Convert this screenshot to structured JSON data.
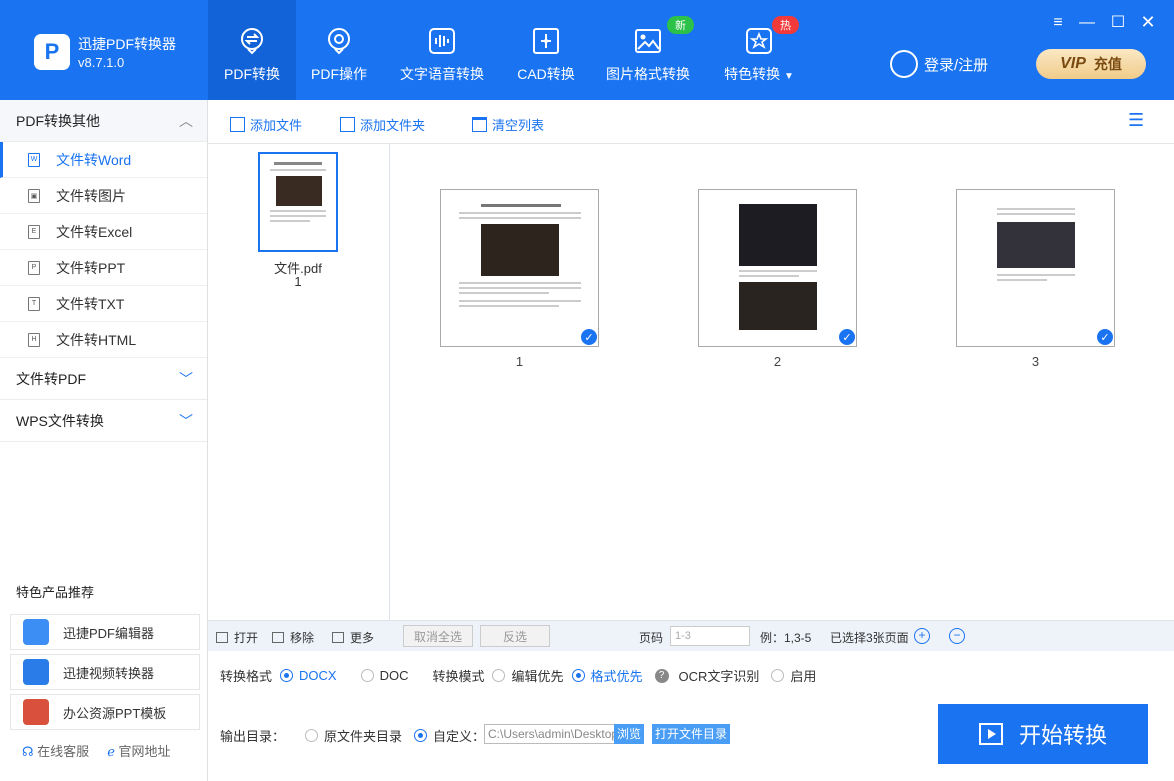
{
  "app": {
    "name": "迅捷PDF转换器",
    "version": "v8.7.1.0"
  },
  "nav": {
    "tabs": [
      {
        "label": "PDF转换",
        "icon": "pdf-convert-icon"
      },
      {
        "label": "PDF操作",
        "icon": "pdf-operate-icon"
      },
      {
        "label": "文字语音转换",
        "icon": "audio-wave-icon"
      },
      {
        "label": "CAD转换",
        "icon": "cad-icon"
      },
      {
        "label": "图片格式转换",
        "icon": "image-icon"
      },
      {
        "label": "特色转换",
        "icon": "star-convert-icon"
      }
    ],
    "badge_new": "新",
    "badge_hot": "热"
  },
  "header": {
    "login": "登录/注册",
    "vip": "VIP",
    "recharge": "充值"
  },
  "sidebar": {
    "section1": "PDF转换其他",
    "items": [
      "文件转Word",
      "文件转图片",
      "文件转Excel",
      "文件转PPT",
      "文件转TXT",
      "文件转HTML"
    ],
    "item_icons": [
      "W",
      "▣",
      "E",
      "P",
      "T",
      "H"
    ],
    "section2": "文件转PDF",
    "section3": "WPS文件转换",
    "rec_title": "特色产品推荐",
    "recs": [
      "迅捷PDF编辑器",
      "迅捷视频转换器",
      "办公资源PPT模板"
    ],
    "online_service": "在线客服",
    "website": "官网地址"
  },
  "toolbar": {
    "add_file": "添加文件",
    "add_folder": "添加文件夹",
    "clear_list": "清空列表"
  },
  "file": {
    "name": "文件.pdf",
    "pages": "1"
  },
  "pages": [
    "1",
    "2",
    "3"
  ],
  "bottombar": {
    "open": "打开",
    "remove": "移除",
    "more": "更多",
    "deselect_all": "取消全选",
    "invert": "反选",
    "page_label": "页码",
    "page_placeholder": "1-3",
    "example": "例：1,3-5",
    "selected": "已选择3张页面"
  },
  "options": {
    "format_label": "转换格式",
    "docx": "DOCX",
    "doc": "DOC",
    "mode_label": "转换模式",
    "edit_first": "编辑优先",
    "format_first": "格式优先",
    "ocr_label": "OCR文字识别",
    "enable": "启用",
    "output_label": "输出目录：",
    "original_dir": "原文件夹目录",
    "custom": "自定义：",
    "path": "C:\\Users\\admin\\Desktop",
    "browse": "浏览",
    "open_dir": "打开文件目录",
    "start": "开始转换"
  },
  "colors": {
    "accent": "#1a73f0",
    "nav_active": "#1262d8",
    "badge_new": "#2cc24a",
    "badge_hot": "#f23a3a"
  }
}
